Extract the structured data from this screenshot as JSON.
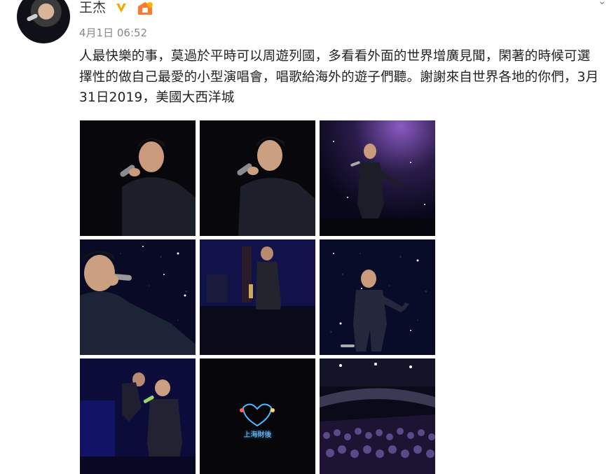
{
  "post": {
    "author": "王杰",
    "time": "4月1日 06:52",
    "text": "人最快樂的事，莫過於平時可以周遊列國，多看看外面的世界增廣見聞，閑著的時候可選擇性的做自己最愛的小型演唱會，唱歌給海外的遊子們聽。謝謝來自世界各地的你們，3月31日2019，美國大西洋城"
  },
  "icons": {
    "verified": "verified-v-icon",
    "member_badge": "member-badge-icon",
    "more": "chevron-down-icon"
  },
  "photo_sign": {
    "text": "上海財後"
  },
  "colors": {
    "verified": "#f4a800",
    "badge": "#ff7a2f",
    "text": "#222222",
    "meta": "#888888"
  }
}
